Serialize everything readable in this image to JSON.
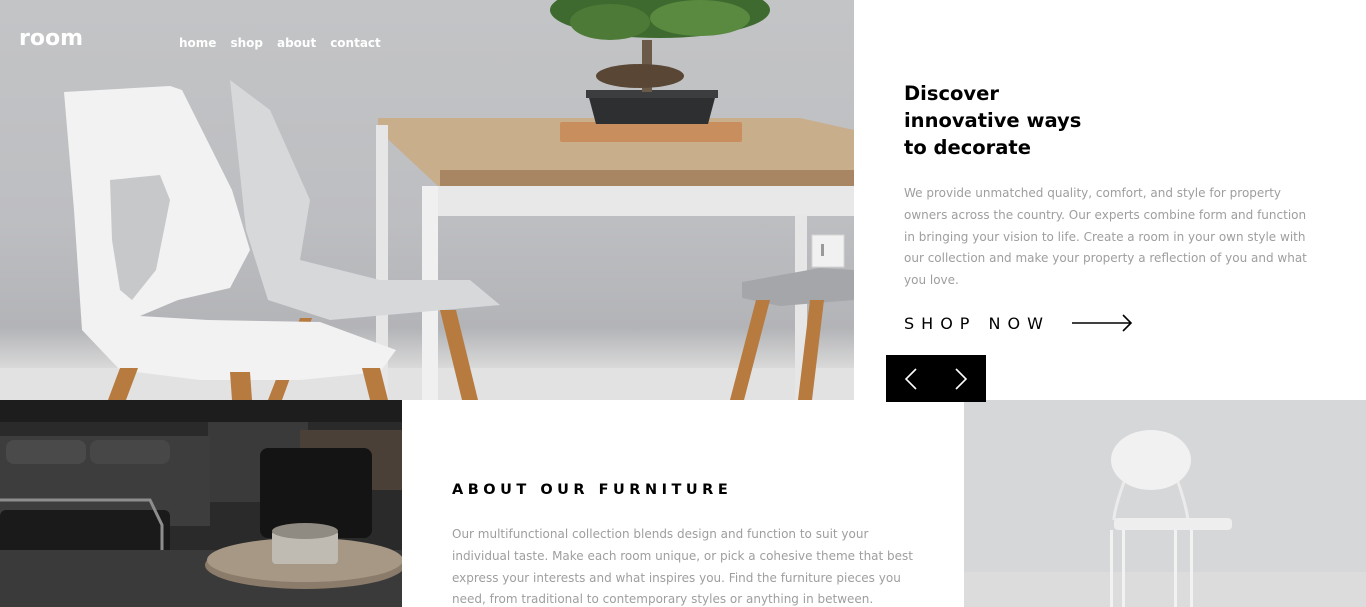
{
  "brand": {
    "logo": "room"
  },
  "nav": {
    "items": [
      {
        "label": "home"
      },
      {
        "label": "shop"
      },
      {
        "label": "about"
      },
      {
        "label": "contact"
      }
    ]
  },
  "hero": {
    "title": "Discover innovative ways to decorate",
    "description": "We provide unmatched quality, comfort, and style for property owners across the country. Our experts combine form and function in bringing your vision to life. Create a room in your own style with our collection and make your property a reflection of you and what you love.",
    "cta_label": "SHOP NOW"
  },
  "about": {
    "title": "ABOUT OUR FURNITURE",
    "description": "Our multifunctional collection blends design and function to suit your individual taste. Make each room unique, or pick a cohesive theme that best express your interests and what inspires you. Find the furniture pieces you need, from traditional to contemporary styles or anything in between. Product specialists are"
  },
  "icons": {
    "prev": "angle-left-icon",
    "next": "angle-right-icon",
    "cta_arrow": "long-arrow-right-icon"
  },
  "colors": {
    "text_primary": "#000000",
    "text_muted": "#9e9e9e",
    "nav_text": "#ffffff",
    "slider_bg": "#000000"
  }
}
